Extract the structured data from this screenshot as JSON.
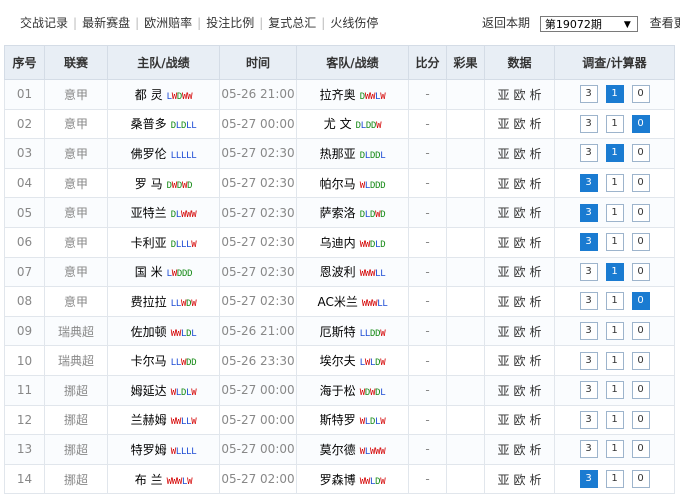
{
  "nav": [
    "交战记录",
    "最新赛盘",
    "欧洲赔率",
    "投注比例",
    "复式总汇",
    "火线伤停"
  ],
  "period": {
    "label": "返回本期",
    "selected": "第19072期",
    "more": "查看更"
  },
  "columns": [
    "序号",
    "联赛",
    "主队/战绩",
    "时间",
    "客队/战绩",
    "比分",
    "彩果",
    "数据",
    "调查/计算器"
  ],
  "data_links": [
    "亚",
    "欧",
    "析"
  ],
  "rows": [
    {
      "no": "01",
      "league": "意甲",
      "home": "都  灵",
      "home_rec": "LWDWW",
      "time": "05-26 21:00",
      "away": "拉齐奥",
      "away_rec": "DWWLW",
      "score": "-",
      "result": "",
      "picks": [
        0,
        1,
        0
      ]
    },
    {
      "no": "02",
      "league": "意甲",
      "home": "桑普多",
      "home_rec": "DLDLL",
      "time": "05-27 00:00",
      "away": "尤  文",
      "away_rec": "DLDDW",
      "score": "-",
      "result": "",
      "picks": [
        0,
        0,
        1
      ]
    },
    {
      "no": "03",
      "league": "意甲",
      "home": "佛罗伦",
      "home_rec": "LLLLL",
      "time": "05-27 02:30",
      "away": "热那亚",
      "away_rec": "DLDDL",
      "score": "-",
      "result": "",
      "picks": [
        0,
        1,
        0
      ]
    },
    {
      "no": "04",
      "league": "意甲",
      "home": "罗  马",
      "home_rec": "DWDWD",
      "time": "05-27 02:30",
      "away": "帕尔马",
      "away_rec": "WLDDD",
      "score": "-",
      "result": "",
      "picks": [
        1,
        0,
        0
      ]
    },
    {
      "no": "05",
      "league": "意甲",
      "home": "亚特兰",
      "home_rec": "DLWWW",
      "time": "05-27 02:30",
      "away": "萨索洛",
      "away_rec": "DLDWD",
      "score": "-",
      "result": "",
      "picks": [
        1,
        0,
        0
      ]
    },
    {
      "no": "06",
      "league": "意甲",
      "home": "卡利亚",
      "home_rec": "DLLLW",
      "time": "05-27 02:30",
      "away": "乌迪内",
      "away_rec": "WWDLD",
      "score": "-",
      "result": "",
      "picks": [
        1,
        0,
        0
      ]
    },
    {
      "no": "07",
      "league": "意甲",
      "home": "国  米",
      "home_rec": "LWDDD",
      "time": "05-27 02:30",
      "away": "恩波利",
      "away_rec": "WWWLL",
      "score": "-",
      "result": "",
      "picks": [
        0,
        1,
        0
      ]
    },
    {
      "no": "08",
      "league": "意甲",
      "home": "费拉拉",
      "home_rec": "LLWDW",
      "time": "05-27 02:30",
      "away": "AC米兰",
      "away_rec": "WWWLL",
      "score": "-",
      "result": "",
      "picks": [
        0,
        0,
        1
      ]
    },
    {
      "no": "09",
      "league": "瑞典超",
      "home": "佐加顿",
      "home_rec": "WWLDL",
      "time": "05-26 21:00",
      "away": "厄斯特",
      "away_rec": "LLDDW",
      "score": "-",
      "result": "",
      "picks": [
        0,
        0,
        0
      ]
    },
    {
      "no": "10",
      "league": "瑞典超",
      "home": "卡尔马",
      "home_rec": "LLWDD",
      "time": "05-26 23:30",
      "away": "埃尔夫",
      "away_rec": "LWLDW",
      "score": "-",
      "result": "",
      "picks": [
        0,
        0,
        0
      ]
    },
    {
      "no": "11",
      "league": "挪超",
      "home": "姆延达",
      "home_rec": "WLDLW",
      "time": "05-27 00:00",
      "away": "海于松",
      "away_rec": "WDWDL",
      "score": "-",
      "result": "",
      "picks": [
        0,
        0,
        0
      ]
    },
    {
      "no": "12",
      "league": "挪超",
      "home": "兰赫姆",
      "home_rec": "WWLLW",
      "time": "05-27 00:00",
      "away": "斯特罗",
      "away_rec": "WLDLW",
      "score": "-",
      "result": "",
      "picks": [
        0,
        0,
        0
      ]
    },
    {
      "no": "13",
      "league": "挪超",
      "home": "特罗姆",
      "home_rec": "WLLLL",
      "time": "05-27 00:00",
      "away": "莫尔德",
      "away_rec": "WLWWW",
      "score": "-",
      "result": "",
      "picks": [
        0,
        0,
        0
      ]
    },
    {
      "no": "14",
      "league": "挪超",
      "home": "布  兰",
      "home_rec": "WWWLW",
      "time": "05-27 02:00",
      "away": "罗森博",
      "away_rec": "WWLDW",
      "score": "-",
      "result": "",
      "picks": [
        1,
        0,
        0
      ]
    }
  ],
  "calc_labels": [
    "3",
    "1",
    "0"
  ],
  "colors": {
    "win": "#d40000",
    "draw": "#1a8c1a",
    "loss": "#1c4bd4",
    "selected": "#1a7bd1",
    "header_bg": "#e8eef5"
  }
}
